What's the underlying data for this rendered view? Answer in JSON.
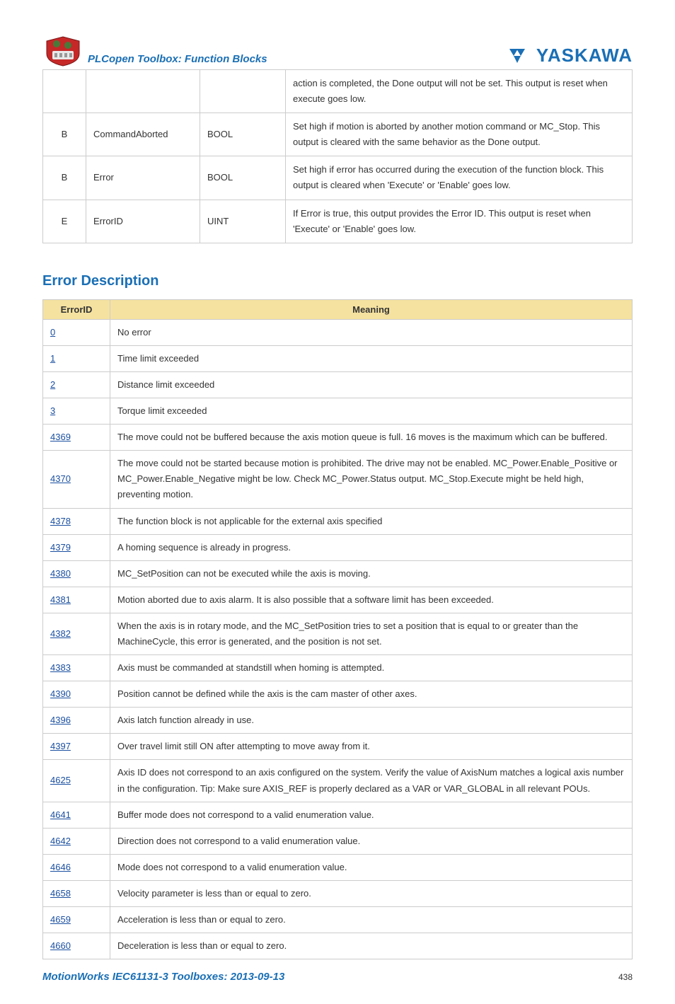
{
  "header": {
    "title": "PLCopen Toolbox: Function Blocks",
    "brand": "YASKAWA"
  },
  "params_table": {
    "rows": [
      {
        "col1": "",
        "name": "",
        "type": "",
        "desc": "action is completed, the Done output will not be set. This output is reset when execute goes low."
      },
      {
        "col1": "B",
        "name": "CommandAborted",
        "type": "BOOL",
        "desc": "Set high if motion is aborted by another motion command or MC_Stop. This output is cleared with the same behavior as the Done output."
      },
      {
        "col1": "B",
        "name": "Error",
        "type": "BOOL",
        "desc": "Set high if error has occurred during the execution of the function block. This output is cleared when 'Execute' or 'Enable' goes low."
      },
      {
        "col1": "E",
        "name": "ErrorID",
        "type": "UINT",
        "desc": "If Error is true, this output provides the Error ID. This output is reset when 'Execute' or 'Enable' goes low."
      }
    ]
  },
  "section_heading": "Error Description",
  "error_table": {
    "headers": {
      "id": "ErrorID",
      "meaning": "Meaning"
    },
    "rows": [
      {
        "id": "0",
        "meaning": "No error"
      },
      {
        "id": "1",
        "meaning": "Time limit exceeded"
      },
      {
        "id": "2",
        "meaning": "Distance limit exceeded"
      },
      {
        "id": "3",
        "meaning": "Torque limit exceeded"
      },
      {
        "id": "4369",
        "meaning": "The move could not be buffered because the axis motion queue is full. 16 moves is the maximum which can be buffered."
      },
      {
        "id": "4370",
        "meaning": "The move could not be started because motion is prohibited. The drive may not be enabled. MC_Power.Enable_Positive or MC_Power.Enable_Negative might be low. Check MC_Power.Status output. MC_Stop.Execute might be held high, preventing motion."
      },
      {
        "id": "4378",
        "meaning": "The function block is not applicable for the external axis specified"
      },
      {
        "id": "4379",
        "meaning": "A homing sequence is already in progress."
      },
      {
        "id": "4380",
        "meaning": "MC_SetPosition can not be executed while the axis is moving."
      },
      {
        "id": "4381",
        "meaning": "Motion aborted due to axis alarm. It is also possible that a software limit has been exceeded."
      },
      {
        "id": "4382",
        "meaning": "When the axis is in rotary mode, and the MC_SetPosition tries to set a position that is equal to or greater than the MachineCycle, this error is generated, and the position is not set."
      },
      {
        "id": "4383",
        "meaning": "Axis must be commanded at standstill when homing is attempted."
      },
      {
        "id": "4390",
        "meaning": "Position cannot be defined while the axis is the cam master of other axes."
      },
      {
        "id": "4396",
        "meaning": "Axis latch function already in use."
      },
      {
        "id": "4397",
        "meaning": "Over travel limit still ON after attempting to move away from it."
      },
      {
        "id": "4625",
        "meaning": "Axis ID does not correspond to an axis configured on the system. Verify the value of AxisNum matches a logical axis number in the configuration. Tip: Make sure AXIS_REF is properly declared as a VAR or VAR_GLOBAL in all relevant POUs."
      },
      {
        "id": "4641",
        "meaning": "Buffer mode does not correspond to a valid enumeration value."
      },
      {
        "id": "4642",
        "meaning": "Direction does not correspond to a valid enumeration value."
      },
      {
        "id": "4646",
        "meaning": "Mode does not correspond to a valid enumeration value."
      },
      {
        "id": "4658",
        "meaning": "Velocity parameter is less than or equal to zero."
      },
      {
        "id": "4659",
        "meaning": "Acceleration is less than or equal to zero."
      },
      {
        "id": "4660",
        "meaning": "Deceleration is less than or equal to zero."
      }
    ]
  },
  "footer": {
    "left": "MotionWorks IEC61131-3 Toolboxes: 2013-09-13",
    "page": "438"
  }
}
